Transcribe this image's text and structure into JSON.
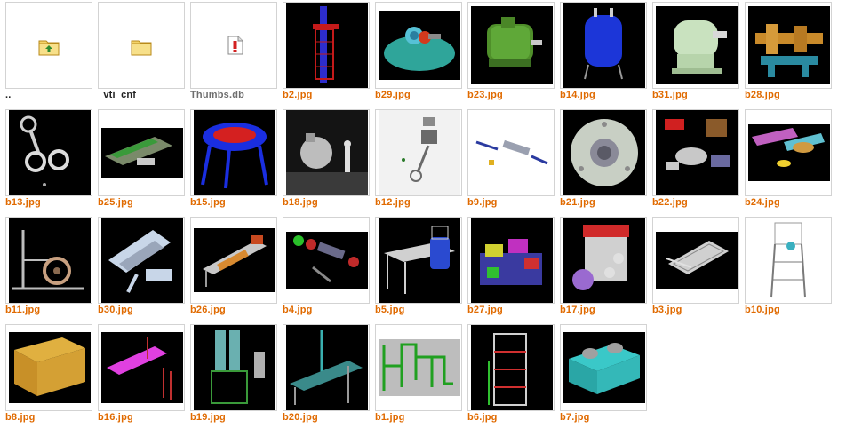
{
  "window": {
    "view": "thumbnails"
  },
  "items": [
    {
      "name": "..",
      "type": "up-folder"
    },
    {
      "name": "_vti_cnf",
      "type": "folder"
    },
    {
      "name": "Thumbs.db",
      "type": "system-file"
    },
    {
      "name": "b2.jpg",
      "type": "image"
    },
    {
      "name": "b29.jpg",
      "type": "image"
    },
    {
      "name": "b23.jpg",
      "type": "image"
    },
    {
      "name": "b14.jpg",
      "type": "image"
    },
    {
      "name": "b31.jpg",
      "type": "image"
    },
    {
      "name": "b28.jpg",
      "type": "image"
    },
    {
      "name": "b13.jpg",
      "type": "image"
    },
    {
      "name": "b25.jpg",
      "type": "image"
    },
    {
      "name": "b15.jpg",
      "type": "image"
    },
    {
      "name": "b18.jpg",
      "type": "image"
    },
    {
      "name": "b12.jpg",
      "type": "image"
    },
    {
      "name": "b9.jpg",
      "type": "image"
    },
    {
      "name": "b21.jpg",
      "type": "image"
    },
    {
      "name": "b22.jpg",
      "type": "image"
    },
    {
      "name": "b24.jpg",
      "type": "image"
    },
    {
      "name": "b11.jpg",
      "type": "image"
    },
    {
      "name": "b30.jpg",
      "type": "image"
    },
    {
      "name": "b26.jpg",
      "type": "image"
    },
    {
      "name": "b4.jpg",
      "type": "image"
    },
    {
      "name": "b5.jpg",
      "type": "image"
    },
    {
      "name": "b27.jpg",
      "type": "image"
    },
    {
      "name": "b17.jpg",
      "type": "image"
    },
    {
      "name": "b3.jpg",
      "type": "image"
    },
    {
      "name": "b10.jpg",
      "type": "image"
    },
    {
      "name": "b8.jpg",
      "type": "image"
    },
    {
      "name": "b16.jpg",
      "type": "image"
    },
    {
      "name": "b19.jpg",
      "type": "image"
    },
    {
      "name": "b20.jpg",
      "type": "image"
    },
    {
      "name": "b1.jpg",
      "type": "image"
    },
    {
      "name": "b6.jpg",
      "type": "image"
    },
    {
      "name": "b7.jpg",
      "type": "image"
    }
  ],
  "colors": {
    "image_label": "#e06a00",
    "folder_label": "#222222",
    "system_label": "#6e6e6e"
  }
}
